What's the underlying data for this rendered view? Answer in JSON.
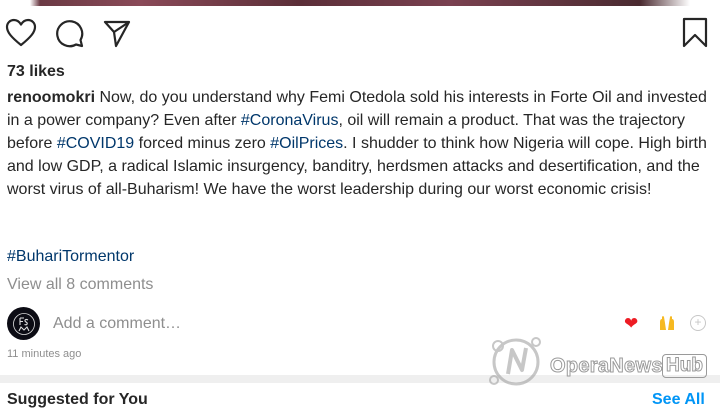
{
  "post": {
    "likes": "73 likes",
    "username": "renoomokri",
    "caption_parts": [
      " Now, do you understand why Femi Otedola sold his interests in Forte Oil and invested in a power company? Even after ",
      "#CoronaVirus",
      ", oil will remain a product. That was the trajectory before ",
      "#COVID19",
      " forced minus zero ",
      "#OilPrices",
      ". I shudder to think how Nigeria will cope. High birth and low GDP, a radical Islamic insurgency, banditry, herdsmen attacks and desertification, and the worst virus of all-Buharism! We have the worst leadership during our worst economic crisis!"
    ],
    "hashtag": "#BuhariTormentor",
    "view_all_comments": "View all 8 comments",
    "add_comment_placeholder": "Add a comment…",
    "timestamp": "11 minutes ago"
  },
  "icons": {
    "like": "heart-outline-icon",
    "comment": "comment-bubble-icon",
    "share": "paper-plane-icon",
    "save": "bookmark-icon",
    "quick_emoji": [
      "red-heart-emoji",
      "raised-hands-emoji",
      "add-emoji-icon"
    ]
  },
  "suggested": {
    "title": "Suggested for You",
    "see_all": "See All"
  },
  "watermark": {
    "text": "OperaNews",
    "box_text": "Hub"
  },
  "colors": {
    "link": "#00376b",
    "muted": "#8e8e8e",
    "accent": "#0095f6",
    "heart": "#ed1c24"
  }
}
